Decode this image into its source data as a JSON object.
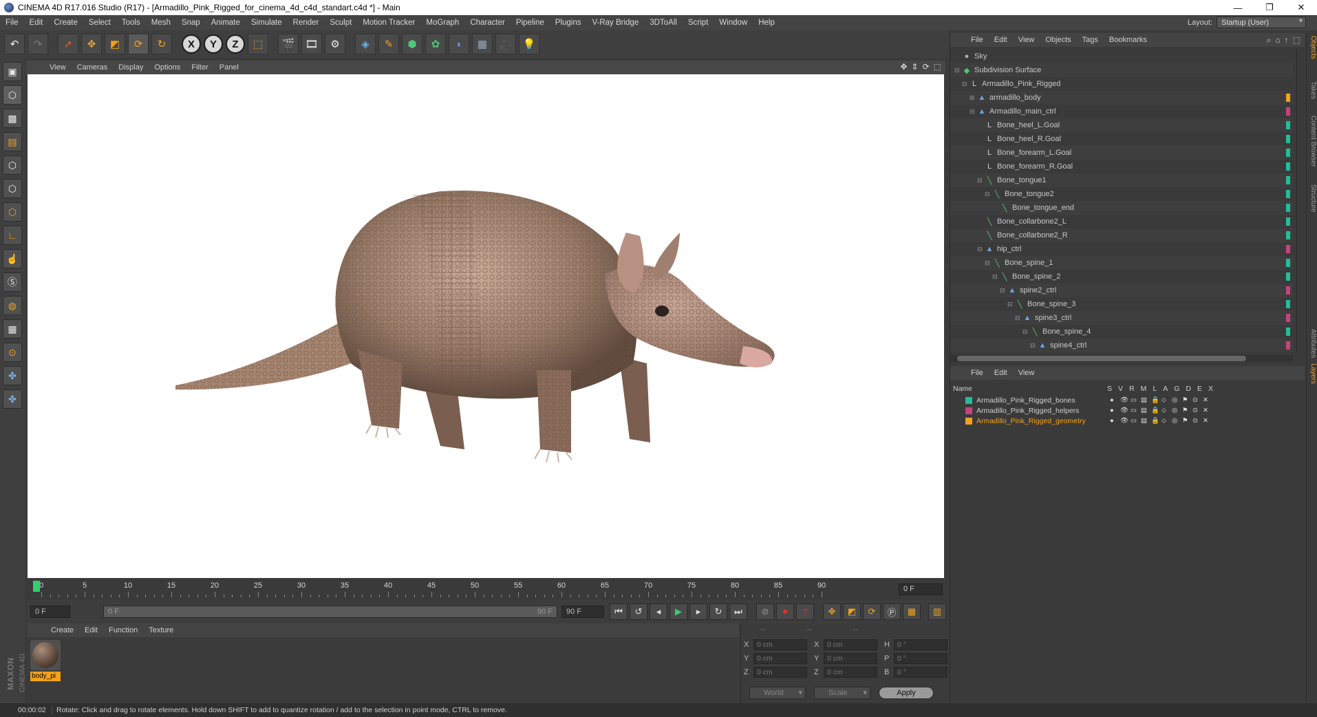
{
  "window": {
    "title": "CINEMA 4D R17.016 Studio (R17) - [Armadillo_Pink_Rigged_for_cinema_4d_c4d_standart.c4d *] - Main",
    "controls": [
      "—",
      "❐",
      "✕"
    ]
  },
  "menubar": {
    "items": [
      "File",
      "Edit",
      "Create",
      "Select",
      "Tools",
      "Mesh",
      "Snap",
      "Animate",
      "Simulate",
      "Render",
      "Sculpt",
      "Motion Tracker",
      "MoGraph",
      "Character",
      "Pipeline",
      "Plugins",
      "V-Ray Bridge",
      "3DToAll",
      "Script",
      "Window",
      "Help"
    ],
    "layout_label": "Layout:",
    "layout_value": "Startup (User)"
  },
  "toolbar": {
    "icons": [
      "undo-icon",
      "redo-icon",
      "select-icon",
      "move-icon",
      "scale-icon",
      "rotate-icon",
      "rotate-alt-icon",
      "x-axis-icon",
      "y-axis-icon",
      "z-axis-icon",
      "world-coord-icon",
      "render-view-icon",
      "render-picture-viewer-icon",
      "render-settings-icon",
      "cube-icon",
      "pen-icon",
      "subdivision-icon",
      "cloner-icon",
      "deformer-icon",
      "floor-icon",
      "camera-icon",
      "light-icon"
    ],
    "axis_labels": [
      "X",
      "Y",
      "Z"
    ]
  },
  "left_tools": {
    "icons": [
      "make-editable-icon",
      "model-mode-icon",
      "texture-mode-icon",
      "workplane-icon",
      "points-mode-icon",
      "edges-mode-icon",
      "polygons-mode-icon",
      "axis-mode-icon",
      "tweak-icon",
      "soft-selection-icon",
      "magnet-icon",
      "snap-lock-icon",
      "snap-icon",
      "python-icon",
      "python-alt-icon"
    ]
  },
  "viewport": {
    "menu": [
      "View",
      "Cameras",
      "Display",
      "Options",
      "Filter",
      "Panel"
    ],
    "nav_icons": [
      "move-view-icon",
      "zoom-view-icon",
      "rotate-view-icon",
      "maximize-view-icon"
    ]
  },
  "timeline": {
    "ticks": [
      "0",
      "5",
      "10",
      "15",
      "20",
      "25",
      "30",
      "35",
      "40",
      "45",
      "50",
      "55",
      "60",
      "65",
      "70",
      "75",
      "80",
      "85",
      "90"
    ],
    "current_frame": "0 F"
  },
  "transport": {
    "start_frame": "0 F",
    "range_start": "0 F",
    "range_end": "90 F",
    "end_frame": "90 F",
    "buttons": [
      "go-start-icon",
      "prev-key-icon",
      "prev-frame-icon",
      "play-icon",
      "next-frame-icon",
      "next-key-icon",
      "go-end-icon",
      "record-icon",
      "auto-key-icon",
      "help-key-icon",
      "key-move-icon",
      "key-scale-icon",
      "key-rotate-icon",
      "key-param-icon",
      "key-pla-icon",
      "timeline-icon"
    ]
  },
  "materials": {
    "menu": [
      "Create",
      "Edit",
      "Function",
      "Texture"
    ],
    "items": [
      {
        "name": "body_pi"
      }
    ]
  },
  "coordinates": {
    "headers": [
      "--",
      "--",
      "--"
    ],
    "rows": [
      {
        "a": "X",
        "av": "0 cm",
        "b": "X",
        "bv": "0 cm",
        "c": "H",
        "cv": "0 °"
      },
      {
        "a": "Y",
        "av": "0 cm",
        "b": "Y",
        "bv": "0 cm",
        "c": "P",
        "cv": "0 °"
      },
      {
        "a": "Z",
        "av": "0 cm",
        "b": "Z",
        "bv": "0 cm",
        "c": "B",
        "cv": "0 °"
      }
    ],
    "space": "World",
    "mode": "Scale",
    "apply": "Apply"
  },
  "status": {
    "time": "00:00:02",
    "message": "Rotate: Click and drag to rotate elements. Hold down SHIFT to add to quantize rotation / add to the selection in point mode, CTRL to remove."
  },
  "logo": {
    "brand": "MAXON",
    "product": "CINEMA 4D"
  },
  "object_manager": {
    "menu": [
      "File",
      "Edit",
      "View",
      "Objects",
      "Tags",
      "Bookmarks"
    ],
    "rows": [
      {
        "name": "Sky",
        "depth": 0,
        "icon": "●",
        "color": "#9bb4d8",
        "tag": ""
      },
      {
        "name": "Subdivision Surface",
        "depth": 0,
        "icon": "◆",
        "color": "#50c878",
        "tag": "",
        "expand": "⊟"
      },
      {
        "name": "Armadillo_Pink_Rigged",
        "depth": 1,
        "icon": "L",
        "color": "#cfcfcf",
        "tag": "",
        "expand": "⊟"
      },
      {
        "name": "armadillo_body",
        "depth": 2,
        "icon": "▲",
        "color": "#6aa6e8",
        "tag": "#f3a21c",
        "expand": "⊞"
      },
      {
        "name": "Armadillo_main_ctrl",
        "depth": 2,
        "icon": "▲",
        "color": "#6aa6e8",
        "tag": "#c8427a",
        "expand": "⊟"
      },
      {
        "name": "Bone_heel_L.Goal",
        "depth": 3,
        "icon": "L",
        "color": "#cfcfcf",
        "tag": "#1fbf9a"
      },
      {
        "name": "Bone_heel_R.Goal",
        "depth": 3,
        "icon": "L",
        "color": "#cfcfcf",
        "tag": "#1fbf9a"
      },
      {
        "name": "Bone_forearm_L.Goal",
        "depth": 3,
        "icon": "L",
        "color": "#cfcfcf",
        "tag": "#1fbf9a"
      },
      {
        "name": "Bone_forearm_R.Goal",
        "depth": 3,
        "icon": "L",
        "color": "#cfcfcf",
        "tag": "#1fbf9a"
      },
      {
        "name": "Bone_tongue1",
        "depth": 3,
        "icon": "╲",
        "color": "#50c878",
        "tag": "#1fbf9a",
        "expand": "⊟"
      },
      {
        "name": "Bone_tongue2",
        "depth": 4,
        "icon": "╲",
        "color": "#50c878",
        "tag": "#1fbf9a",
        "expand": "⊟"
      },
      {
        "name": "Bone_tongue_end",
        "depth": 5,
        "icon": "╲",
        "color": "#50c878",
        "tag": "#1fbf9a"
      },
      {
        "name": "Bone_collarbone2_L",
        "depth": 3,
        "icon": "╲",
        "color": "#50c878",
        "tag": "#1fbf9a"
      },
      {
        "name": "Bone_collarbone2_R",
        "depth": 3,
        "icon": "╲",
        "color": "#50c878",
        "tag": "#1fbf9a"
      },
      {
        "name": "hip_ctrl",
        "depth": 3,
        "icon": "▲",
        "color": "#6aa6e8",
        "tag": "#c8427a",
        "expand": "⊟"
      },
      {
        "name": "Bone_spine_1",
        "depth": 4,
        "icon": "╲",
        "color": "#50c878",
        "tag": "#1fbf9a",
        "expand": "⊟"
      },
      {
        "name": "Bone_spine_2",
        "depth": 5,
        "icon": "╲",
        "color": "#50c878",
        "tag": "#1fbf9a",
        "expand": "⊟"
      },
      {
        "name": "spine2_ctrl",
        "depth": 6,
        "icon": "▲",
        "color": "#6aa6e8",
        "tag": "#c8427a",
        "expand": "⊟"
      },
      {
        "name": "Bone_spine_3",
        "depth": 7,
        "icon": "╲",
        "color": "#50c878",
        "tag": "#1fbf9a",
        "expand": "⊟"
      },
      {
        "name": "spine3_ctrl",
        "depth": 8,
        "icon": "▲",
        "color": "#6aa6e8",
        "tag": "#c8427a",
        "expand": "⊟"
      },
      {
        "name": "Bone_spine_4",
        "depth": 9,
        "icon": "╲",
        "color": "#50c878",
        "tag": "#1fbf9a",
        "expand": "⊟"
      },
      {
        "name": "spine4_ctrl",
        "depth": 10,
        "icon": "▲",
        "color": "#6aa6e8",
        "tag": "#c8427a",
        "expand": "⊟"
      }
    ]
  },
  "layer_manager": {
    "menu": [
      "File",
      "Edit",
      "View"
    ],
    "columns": [
      "Name",
      "S",
      "V",
      "R",
      "M",
      "L",
      "A",
      "G",
      "D",
      "E",
      "X"
    ],
    "layers": [
      {
        "name": "Armadillo_Pink_Rigged_bones",
        "color": "#1fbf9a",
        "highlight": false
      },
      {
        "name": "Armadillo_Pink_Rigged_helpers",
        "color": "#c8427a",
        "highlight": false
      },
      {
        "name": "Armadillo_Pink_Rigged_geometry",
        "color": "#f3a21c",
        "highlight": true
      }
    ]
  },
  "side_tabs": [
    "Objects",
    "Takes",
    "Content Browser",
    "Structure",
    "Attributes",
    "Layers"
  ]
}
